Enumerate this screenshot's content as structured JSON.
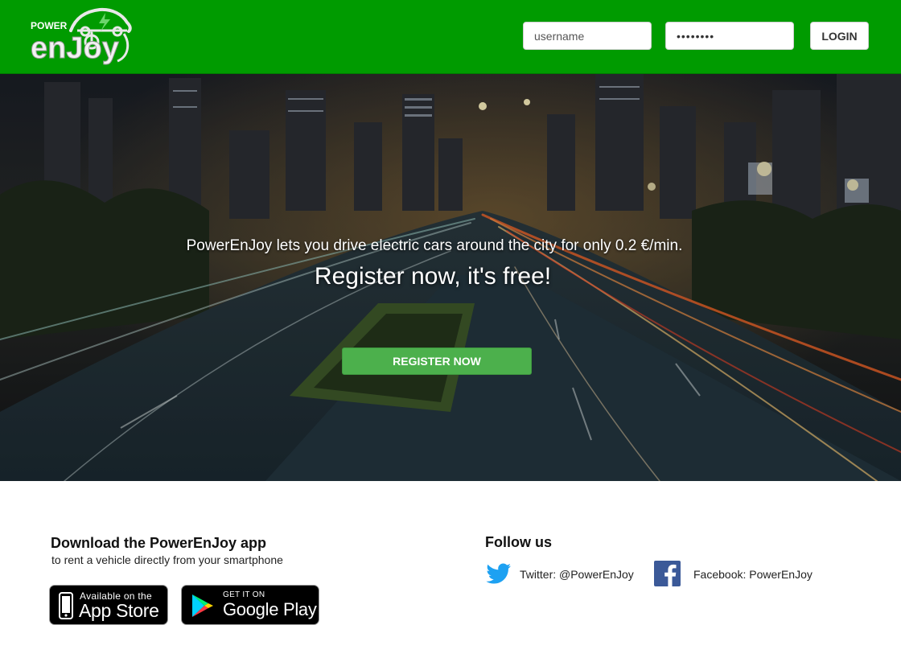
{
  "brand": {
    "logo_word_power": "POWER",
    "logo_word_enjoy": "enJoy",
    "color_header": "#009b00",
    "color_button": "#4cb04c"
  },
  "header": {
    "username_placeholder": "username",
    "password_value": "password",
    "login_label": "LOGIN"
  },
  "hero": {
    "tagline": "PowerEnJoy lets you drive electric cars around the city for only 0.2 €/min.",
    "cta_title": "Register now, it's free!",
    "register_button": "REGISTER NOW"
  },
  "download": {
    "title": "Download the PowerEnJoy app",
    "subtitle": "to rent a vehicle directly from your smartphone",
    "app_store": {
      "small": "Available on the",
      "big": "App Store",
      "icon": "phone-icon"
    },
    "google_play": {
      "small": "GET IT ON",
      "big": "Google Play",
      "icon": "play-triangle-icon"
    }
  },
  "follow": {
    "title": "Follow us",
    "twitter_label": "Twitter: @PowerEnJoy",
    "facebook_label": "Facebook: PowerEnJoy",
    "twitter_color": "#1da1f2",
    "facebook_color": "#3b5998"
  }
}
